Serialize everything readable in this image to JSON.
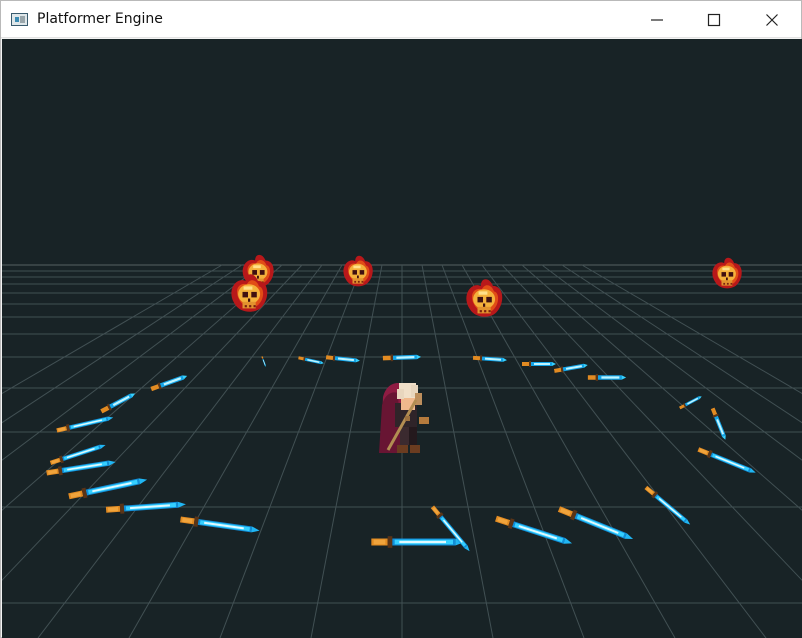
{
  "window": {
    "title": "Platformer Engine",
    "icon": "app-icon",
    "controls": [
      "minimize-icon",
      "maximize-icon",
      "close-icon"
    ]
  },
  "scene": {
    "background": "#182326",
    "grid_color": "#465558",
    "horizon_color": "#52605f",
    "player": {
      "name": "hero-knight",
      "cape_color": "#7b1736",
      "hair_color": "#f0dfc8"
    },
    "enemies": [
      {
        "name": "flaming-skull-left-rear"
      },
      {
        "name": "flaming-skull-left-front"
      },
      {
        "name": "flaming-skull-center-left"
      },
      {
        "name": "flaming-skull-center"
      },
      {
        "name": "flaming-skull-right"
      }
    ],
    "projectile": {
      "name": "orbiting-sword",
      "blade_color": "#16b7f2",
      "hilt_color": "#e28b22"
    }
  }
}
